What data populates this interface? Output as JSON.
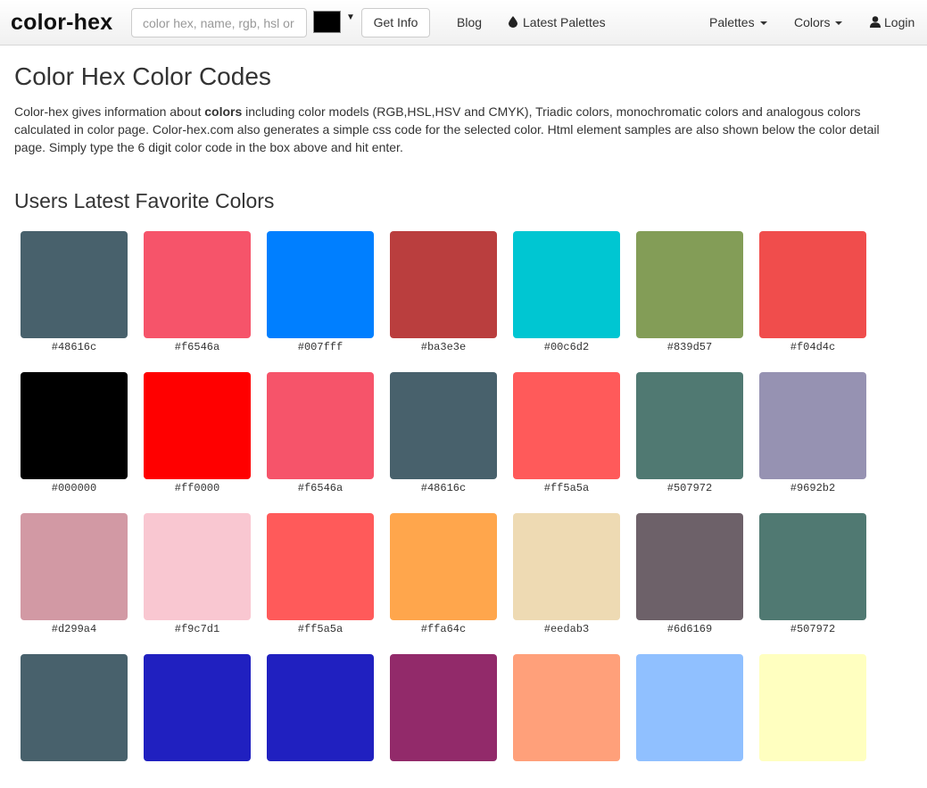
{
  "navbar": {
    "brand": "color-hex",
    "search_placeholder": "color hex, name, rgb, hsl or",
    "picker_color": "#000000",
    "get_info_label": "Get Info",
    "blog_label": "Blog",
    "latest_palettes_label": "Latest Palettes",
    "palettes_label": "Palettes",
    "colors_label": "Colors",
    "login_label": "Login"
  },
  "main": {
    "title": "Color Hex Color Codes",
    "intro_before": "Color-hex gives information about ",
    "intro_bold": "colors",
    "intro_after": " including color models (RGB,HSL,HSV and CMYK), Triadic colors, monochromatic colors and analogous colors calculated in color page. Color-hex.com also generates a simple css code for the selected color. Html element samples are also shown below the color detail page. Simply type the 6 digit color code in the box above and hit enter.",
    "section_title": "Users Latest Favorite Colors"
  },
  "colors": [
    [
      "#48616c",
      "#f6546a",
      "#007fff",
      "#ba3e3e",
      "#00c6d2",
      "#839d57",
      "#f04d4c"
    ],
    [
      "#000000",
      "#ff0000",
      "#f6546a",
      "#48616c",
      "#ff5a5a",
      "#507972",
      "#9692b2"
    ],
    [
      "#d299a4",
      "#f9c7d1",
      "#ff5a5a",
      "#ffa64c",
      "#eedab3",
      "#6d6169",
      "#507972"
    ],
    [
      "#48616c",
      "#2020c0",
      "#2020c0",
      "#922a6a",
      "#ffa07a",
      "#90c0ff",
      "#ffffc0"
    ]
  ],
  "last_row_labels_visible": false
}
